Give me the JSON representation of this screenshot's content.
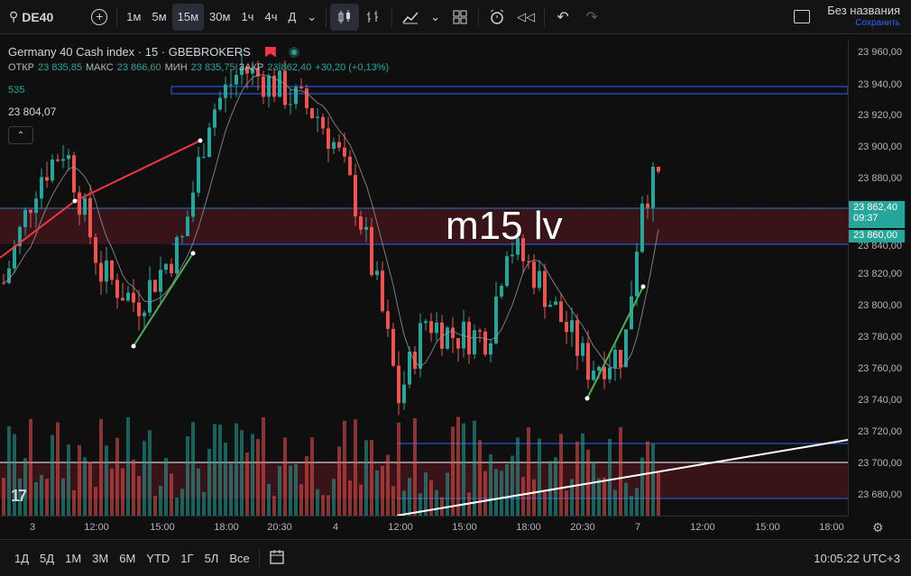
{
  "toolbar": {
    "symbol": "DE40",
    "intervals": [
      "1м",
      "5м",
      "15м",
      "30м",
      "1ч",
      "4ч",
      "Д"
    ],
    "active_interval": "15м",
    "layout_name": "Без названия",
    "save_label": "Сохранить"
  },
  "legend": {
    "title": "Germany 40 Cash index · 15 · GBEBROKERS",
    "open_label": "ОТКР",
    "open": "23 835,85",
    "high_label": "МАКС",
    "high": "23 866,60",
    "low_label": "МИН",
    "low": "23 835,75",
    "close_label": "ЗАКР",
    "close": "23 862,40",
    "change": "+30,20 (+0,13%)",
    "volume": "535",
    "crosshair_price": "23 804,07"
  },
  "annotation": "m15 lv",
  "price_axis": {
    "labels": [
      "23 960,00",
      "23 940,00",
      "23 920,00",
      "23 900,00",
      "23 880,00",
      "23 840,00",
      "23 820,00",
      "23 800,00",
      "23 780,00",
      "23 760,00",
      "23 740,00",
      "23 720,00",
      "23 700,00",
      "23 680,00"
    ],
    "last_price": "23 862,40",
    "countdown": "09:37",
    "level_price": "23 860,00"
  },
  "time_axis": {
    "labels": [
      "3",
      "12:00",
      "15:00",
      "18:00",
      "20:30",
      "4",
      "12:00",
      "15:00",
      "18:00",
      "20:30",
      "7",
      "12:00",
      "15:00",
      "18:00"
    ]
  },
  "bottom": {
    "ranges": [
      "1Д",
      "5Д",
      "1М",
      "3М",
      "6М",
      "YTD",
      "1Г",
      "5Л",
      "Все"
    ],
    "clock": "10:05:22 UTC+3"
  },
  "colors": {
    "up": "#26a69a",
    "down": "#ef5350",
    "zone": "#3d1418",
    "line_blue": "#2962ff",
    "trend_red": "#f23645"
  }
}
